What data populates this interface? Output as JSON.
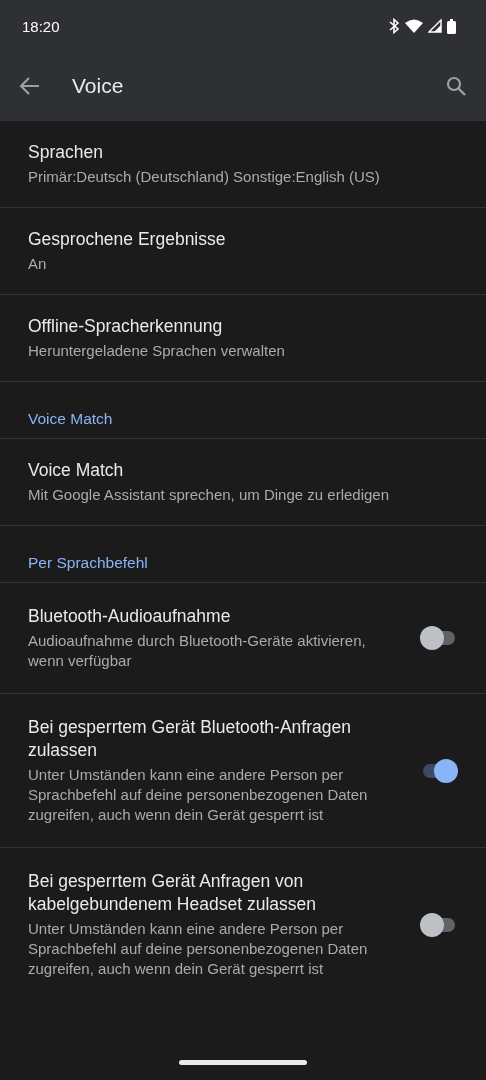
{
  "status_bar": {
    "time": "18:20"
  },
  "app_bar": {
    "title": "Voice"
  },
  "items": [
    {
      "kind": "item",
      "title": "Sprachen",
      "subtitle": "Primär:Deutsch (Deutschland) Sonstige:English (US)"
    },
    {
      "kind": "item",
      "title": "Gesprochene Ergebnisse",
      "subtitle": "An"
    },
    {
      "kind": "item",
      "title": "Offline-Spracherkennung",
      "subtitle": "Heruntergeladene Sprachen verwalten"
    },
    {
      "kind": "header",
      "title": "Voice Match"
    },
    {
      "kind": "item",
      "title": "Voice Match",
      "subtitle": "Mit Google Assistant sprechen, um Dinge zu erledigen"
    },
    {
      "kind": "header",
      "title": "Per Sprachbefehl"
    },
    {
      "kind": "toggle",
      "title": "Bluetooth-Audioaufnahme",
      "subtitle": "Audioaufnahme durch Bluetooth-Geräte aktivieren, wenn verfügbar",
      "on": false
    },
    {
      "kind": "toggle",
      "title": "Bei gesperrtem Gerät Bluetooth-Anfragen zulassen",
      "subtitle": "Unter Umständen kann eine andere Person per Sprachbefehl auf deine personenbezogenen Daten zugreifen, auch wenn dein Gerät gesperrt ist",
      "on": true
    },
    {
      "kind": "toggle",
      "title": "Bei gesperrtem Gerät Anfragen von kabelgebundenem Headset zulassen",
      "subtitle": "Unter Umständen kann eine andere Person per Sprachbefehl auf deine personenbezogenen Daten zugreifen, auch wenn dein Gerät gesperrt ist",
      "on": false
    }
  ]
}
